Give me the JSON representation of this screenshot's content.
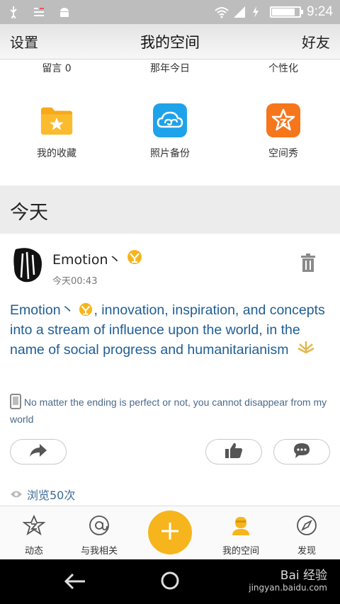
{
  "status_bar": {
    "time": "9:24",
    "battery_level": 0.85,
    "icons": [
      "usb-icon",
      "data-switch-icon",
      "android-icon",
      "wifi-icon",
      "signal-icon",
      "charging-icon",
      "battery-icon"
    ]
  },
  "header": {
    "left": "设置",
    "title": "我的空间",
    "right": "好友"
  },
  "grid_top": {
    "items": [
      {
        "label": "留言 0"
      },
      {
        "label": "那年今日"
      },
      {
        "label": "个性化"
      }
    ]
  },
  "grid": {
    "items": [
      {
        "label": "我的收藏",
        "icon": "favorites-folder-icon",
        "color": "#f7a91a"
      },
      {
        "label": "照片备份",
        "icon": "cloud-backup-icon",
        "color": "#1ea2ea"
      },
      {
        "label": "空间秀",
        "icon": "star-show-icon",
        "color": "#f6761c"
      }
    ]
  },
  "section": {
    "title": "今天"
  },
  "post": {
    "username": "Emotion丶",
    "time": "今天00:43",
    "text_before": "Emotion丶",
    "text_after": ", innovation, inspiration, and concepts into a stream of influence upon the world, in the name of social progress and humanitarianism",
    "device_text": "No matter the ending is perfect or not, you cannot disappear from my world",
    "views": "浏览50次"
  },
  "bottom_nav": {
    "items": [
      {
        "label": "动态",
        "icon": "feed-star-icon"
      },
      {
        "label": "与我相关",
        "icon": "at-icon"
      },
      {
        "label": "我的空间",
        "icon": "my-space-icon"
      },
      {
        "label": "发现",
        "icon": "compass-icon"
      }
    ],
    "accent": "#f7b51d"
  },
  "watermark": {
    "top": "Bai 经验",
    "bottom": "jingyan.baidu.com"
  }
}
